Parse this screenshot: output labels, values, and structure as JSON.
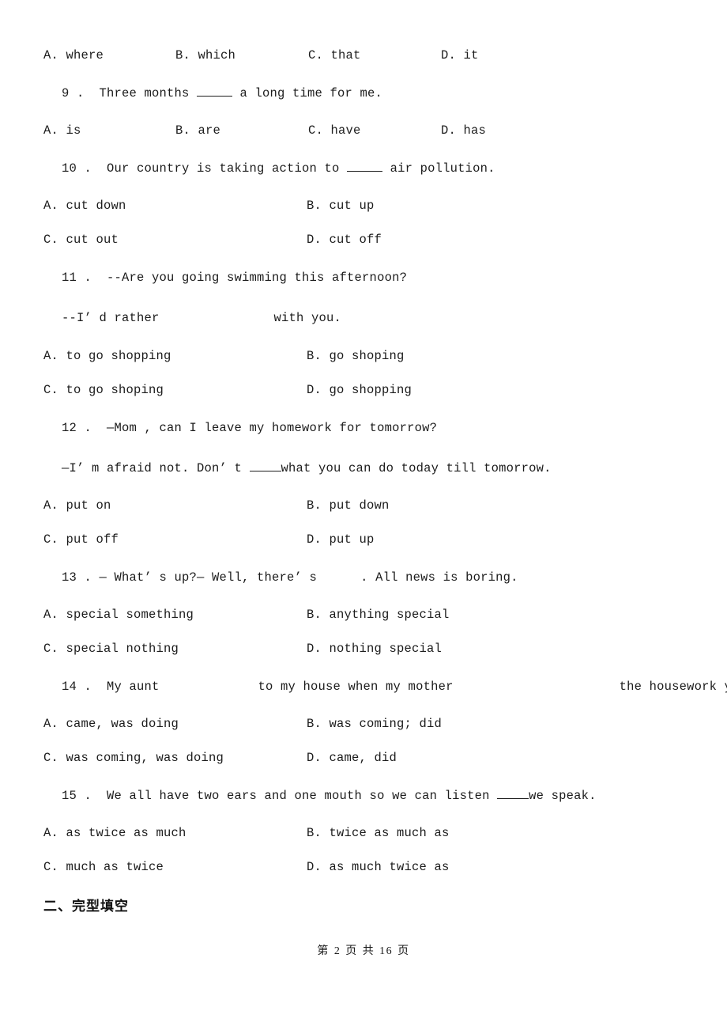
{
  "page": {
    "footer_prefix": "第",
    "footer_page_number": "2",
    "footer_middle": "页 共",
    "footer_total_pages": "16",
    "footer_suffix": "页",
    "footer_full": "第 2 页 共 16 页",
    "background_color": "#ffffff",
    "text_color": "#1c1c1c"
  },
  "q8_options": {
    "a": "A. where",
    "b": "B. which",
    "c": "C. that",
    "d": "D. it"
  },
  "questions": [
    {
      "number": "9",
      "stem_before": "9 .  Three months ",
      "stem_after": " a long time for me.",
      "blank_type": "underline",
      "layout": "four-column",
      "options": {
        "a": "A. is",
        "b": "B. are",
        "c": "C. have",
        "d": "D. has"
      }
    },
    {
      "number": "10",
      "stem_before": "10 .  Our country is taking action to ",
      "stem_after": " air pollution.",
      "blank_type": "underline",
      "layout": "two-column",
      "options": {
        "a": "A. cut down",
        "b": "B. cut up",
        "c": "C. cut out",
        "d": "D. cut off"
      }
    },
    {
      "number": "11",
      "stem_line1": "11 .  --Are you going swimming this afternoon?",
      "stem_line2_before": "--I’ d rather",
      "stem_line2_after": "with you.",
      "blank_type": "gap",
      "layout": "two-column",
      "options": {
        "a": "A. to go shopping",
        "b": "B. go shoping",
        "c": "C. to go shoping",
        "d": "D. go shopping"
      }
    },
    {
      "number": "12",
      "stem_line1": "12 .  —Mom , can I leave my homework for tomorrow?",
      "stem_line2_before": "—I’ m afraid not. Don’ t ",
      "stem_line2_after": "what you can do today till tomorrow.",
      "blank_type": "underline",
      "layout": "two-column",
      "options": {
        "a": "A. put on",
        "b": "B. put down",
        "c": "C. put off",
        "d": "D. put up"
      }
    },
    {
      "number": "13",
      "stem_before": "13 . — What’ s up?— Well, there’ s",
      "stem_after": ". All news is boring.",
      "blank_type": "gap",
      "layout": "two-column",
      "options": {
        "a": "A. special something",
        "b": "B. anything special",
        "c": "C. special nothing",
        "d": "D. nothing special"
      }
    },
    {
      "number": "14",
      "stem_part1": "14 .  My aunt",
      "stem_part2": "to my house when my mother",
      "stem_part3": "the housework yesterday.",
      "blank_type": "gap",
      "layout": "two-column",
      "options": {
        "a": "A. came, was doing",
        "b": "B. was coming; did",
        "c": "C. was coming, was doing",
        "d": "D. came, did"
      }
    },
    {
      "number": "15",
      "stem_before": "15 .  We all have two ears and one mouth so we can listen ",
      "stem_after": "we speak.",
      "blank_type": "underline",
      "layout": "two-column",
      "options": {
        "a": "A. as twice as much",
        "b": "B. twice as much as",
        "c": "C. much as twice",
        "d": "D. as much twice as"
      }
    }
  ],
  "section": {
    "heading": "二、完型填空"
  }
}
